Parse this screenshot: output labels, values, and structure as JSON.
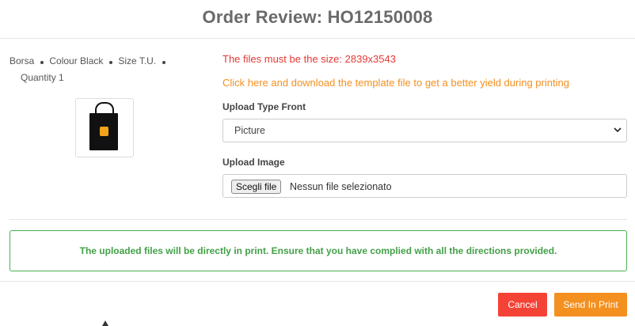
{
  "modal": {
    "title": "Order Review: HO12150008"
  },
  "product": {
    "type": "Borsa",
    "colour": "Colour Black",
    "size": "Size T.U.",
    "quantity": "Quantity 1",
    "thumbnail_icon": "tote-bag-image"
  },
  "upload": {
    "size_warning": "The files must be the size: 2839x3543",
    "template_link": "Click here and download the template file to get a better yield during printing",
    "type_label": "Upload Type Front",
    "type_value": "Picture",
    "image_label": "Upload Image",
    "file_button": "Scegli file",
    "file_status": "Nessun file selezionato"
  },
  "notice": {
    "text": "The uploaded files will be directly in print. Ensure that you have complied with all the directions provided."
  },
  "actions": {
    "cancel": "Cancel",
    "send": "Send In Print"
  },
  "colors": {
    "warning": "#e53935",
    "link": "#f39020",
    "success": "#43a047",
    "cancel_button": "#f44336",
    "send_button": "#f39020"
  }
}
